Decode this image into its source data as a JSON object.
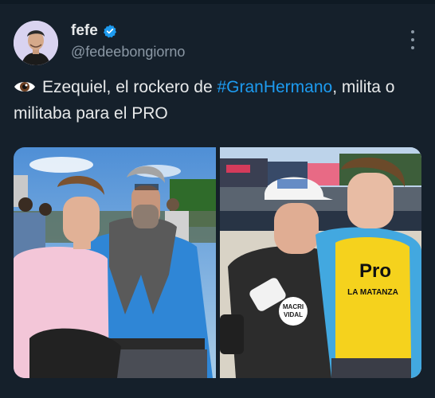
{
  "author": {
    "display_name": "fefe",
    "handle": "@fedeebongiorno",
    "verified": true
  },
  "tweet": {
    "emoji_icon": "eye-icon",
    "text_before": "Ezequiel, el rockero de ",
    "hashtag": "#GranHermano",
    "text_after": ", milita o militaba para el PRO"
  },
  "media": {
    "photo_right_shirt_text": "Pro",
    "photo_right_shirt_subtext": "LA MATANZA",
    "photo_right_badge_line1": "MACRI",
    "photo_right_badge_line2": "VIDAL"
  },
  "colors": {
    "background": "#15202b",
    "text": "#e7e9ea",
    "secondary_text": "#8b98a5",
    "link": "#1d9bf0"
  },
  "icons": {
    "verified": "verified-badge-icon",
    "more": "more-options-icon"
  }
}
